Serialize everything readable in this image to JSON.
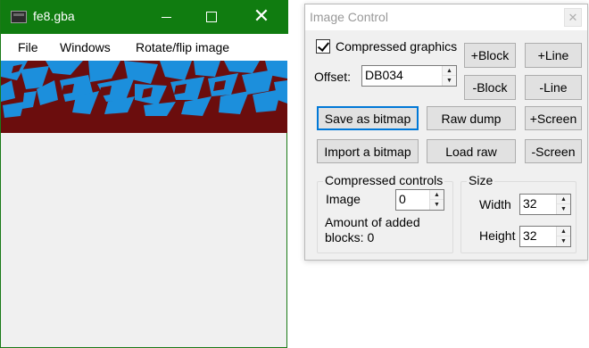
{
  "main_window": {
    "title": "fe8.gba",
    "menu": [
      "File",
      "Windows",
      "Rotate/flip image"
    ],
    "titlebar_color": "#107c10",
    "graphic_colors": {
      "background": "#6b0d0d",
      "foreground": "#1c8fdc"
    }
  },
  "image_control": {
    "title": "Image Control",
    "compressed_graphics_label": "Compressed graphics",
    "compressed_graphics_checked": true,
    "offset_label": "Offset:",
    "offset_value": "DB034",
    "buttons": {
      "plus_block": "+Block",
      "plus_line": "+Line",
      "minus_block": "-Block",
      "minus_line": "-Line",
      "save_bitmap": "Save as bitmap",
      "raw_dump": "Raw dump",
      "plus_screen": "+Screen",
      "import_bitmap": "Import a bitmap",
      "load_raw": "Load raw",
      "minus_screen": "-Screen"
    },
    "compressed_controls": {
      "legend": "Compressed controls",
      "image_label": "Image",
      "image_value": "0",
      "added_blocks_text_1": "Amount of added",
      "added_blocks_text_2": "blocks: 0"
    },
    "size": {
      "legend": "Size",
      "width_label": "Width",
      "width_value": "32",
      "height_label": "Height",
      "height_value": "32"
    }
  }
}
